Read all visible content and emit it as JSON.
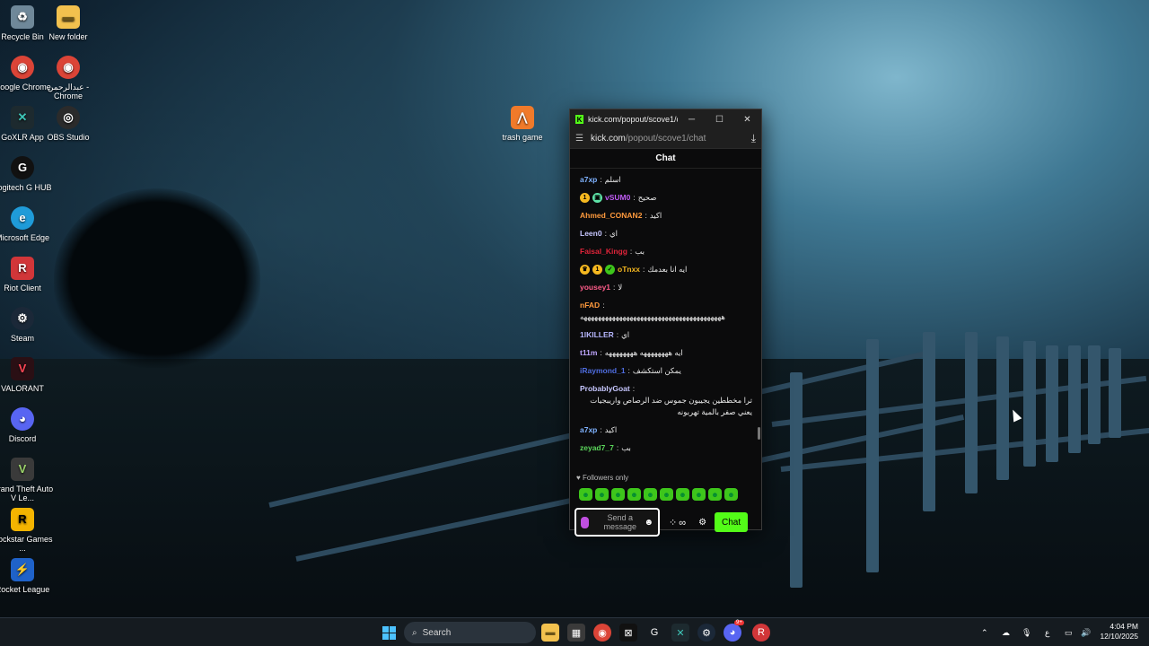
{
  "desktop": {
    "icons": [
      {
        "label": "Recycle Bin",
        "icon": "recycle-bin-icon",
        "color": "#9fb7c9",
        "glyph": "♻"
      },
      {
        "label": "New folder",
        "icon": "folder-icon",
        "color": "#f2c14e",
        "glyph": "▬"
      },
      {
        "label": "Google Chrome",
        "icon": "chrome-icon",
        "color": "#db4437",
        "glyph": "◉"
      },
      {
        "label": "عبدالرحمن - Chrome",
        "icon": "chrome-icon",
        "color": "#db4437",
        "glyph": "◉"
      },
      {
        "label": "GoXLR App",
        "icon": "goxlr-icon",
        "color": "#1d2a2f",
        "glyph": "✕"
      },
      {
        "label": "OBS Studio",
        "icon": "obs-icon",
        "color": "#2b2b2b",
        "glyph": "◎"
      },
      {
        "label": "Logitech G HUB",
        "icon": "logitech-icon",
        "color": "#111",
        "glyph": "G"
      },
      {
        "label": "Microsoft Edge",
        "icon": "edge-icon",
        "color": "#1f9bd8",
        "glyph": "e"
      },
      {
        "label": "Riot Client",
        "icon": "riot-icon",
        "color": "#d13639",
        "glyph": "R"
      },
      {
        "label": "Steam",
        "icon": "steam-icon",
        "color": "#1b2838",
        "glyph": "⚙"
      },
      {
        "label": "VALORANT",
        "icon": "valorant-icon",
        "color": "#2a0f14",
        "glyph": "V"
      },
      {
        "label": "Discord",
        "icon": "discord-icon",
        "color": "#5865f2",
        "glyph": "◕"
      },
      {
        "label": "Grand Theft Auto V Le...",
        "icon": "gta-icon",
        "color": "#3a3a3a",
        "glyph": "V"
      },
      {
        "label": "Rockstar Games ...",
        "icon": "rockstar-icon",
        "color": "#f4b400",
        "glyph": "R"
      },
      {
        "label": "Rocket League",
        "icon": "rocket-league-icon",
        "color": "#1f62c9",
        "glyph": "⚡"
      },
      {
        "label": "trash game",
        "icon": "trash-game-icon",
        "color": "#f07a2a",
        "glyph": "⋀"
      }
    ]
  },
  "window": {
    "title": "kick.com/popout/scove1/ch...",
    "url_host": "kick.com",
    "url_path": "/popout/scove1/chat",
    "chat_title": "Chat",
    "messages": [
      {
        "user": "a7xp",
        "color": "#7fb2ff",
        "text": "اسلم",
        "badges": []
      },
      {
        "user": "vSUM0",
        "color": "#c05cf5",
        "text": "صحيح",
        "badges": [
          {
            "glyph": "1",
            "color": "#f5b820"
          },
          {
            "glyph": "▣",
            "color": "#5ee3a8"
          }
        ]
      },
      {
        "user": "Ahmed_CONAN2",
        "color": "#ff9a3d",
        "text": "اكيد",
        "badges": []
      },
      {
        "user": "Leen0",
        "color": "#c7c7ff",
        "text": "اي",
        "badges": []
      },
      {
        "user": "Faisal_Kingg",
        "color": "#e0243a",
        "text": "بب",
        "badges": []
      },
      {
        "user": "oTnxx",
        "color": "#f5b820",
        "text": "ايه انا بعدمك",
        "badges": [
          {
            "glyph": "♛",
            "color": "#f5b820"
          },
          {
            "glyph": "1",
            "color": "#f5b820"
          },
          {
            "glyph": "✓",
            "color": "#3ec61b"
          }
        ]
      },
      {
        "user": "yousey1",
        "color": "#ff5c8a",
        "text": "لا",
        "badges": []
      },
      {
        "user": "nFAD",
        "color": "#ff9a3d",
        "text": "ههههههههههههههههههههههههههههههههههههههههه",
        "badges": []
      },
      {
        "user": "1lKILLER",
        "color": "#b7b7ff",
        "text": "اي",
        "badges": []
      },
      {
        "user": "t11m",
        "color": "#bfa6ff",
        "text": "ايه ههههههههه ههههههههه",
        "badges": []
      },
      {
        "user": "iRaymond_1",
        "color": "#4f6de0",
        "text": "يمكن استكشف",
        "badges": []
      },
      {
        "user": "ProbablyGoat",
        "color": "#c7c7ff",
        "text": "ترا مخططين يجيبون جموس ضد الرصاص واريبجيات يعني صفر بالمية تهربونه",
        "badges": []
      },
      {
        "user": "a7xp",
        "color": "#7fb2ff",
        "text": "اكيد",
        "badges": []
      },
      {
        "user": "zeyad7_7",
        "color": "#5bd65b",
        "text": "بب",
        "badges": []
      }
    ],
    "followers_only": "Followers only",
    "emotes": [
      "emote-1",
      "emote-2",
      "emote-3",
      "emote-4",
      "emote-5",
      "emote-6",
      "emote-7",
      "emote-8",
      "emote-9",
      "emote-10"
    ],
    "input_placeholder": "Send a message",
    "chat_button": "Chat"
  },
  "taskbar": {
    "search_label": "Search",
    "time": "4:04 PM",
    "date": "12/10/2025",
    "lang": "ع",
    "discord_badge": "9+"
  },
  "colors": {
    "accent": "#53fc18"
  }
}
